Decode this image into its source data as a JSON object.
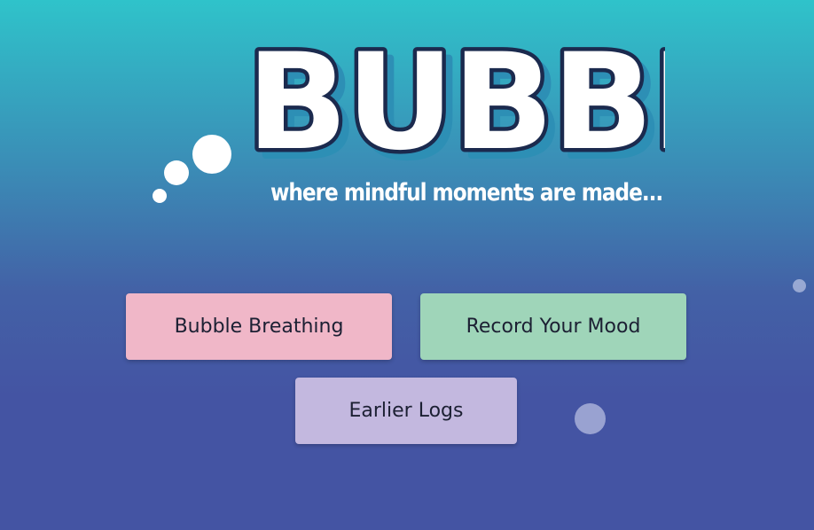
{
  "app": {
    "logo_text": "BUBBLE",
    "tagline": "where mindful moments are made..."
  },
  "actions": {
    "bubble_breathing": "Bubble Breathing",
    "record_mood": "Record Your Mood",
    "earlier_logs": "Earlier Logs"
  },
  "colors": {
    "background_top": "#2fc3ca",
    "background_bottom": "#4454a3",
    "logo_fill": "#ffffff",
    "logo_outline": "#1b2a4e",
    "logo_shadow": "#2d8fb5",
    "breathing_button": "#f0b7c8",
    "mood_button": "#9fd5b9",
    "logs_button": "#c3b8df"
  }
}
